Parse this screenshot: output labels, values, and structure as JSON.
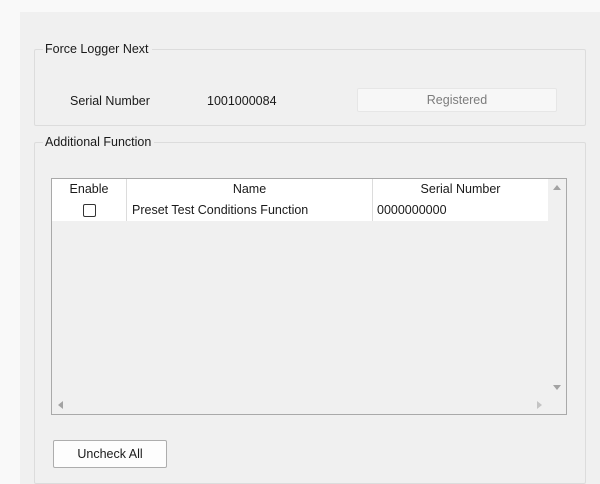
{
  "force_logger": {
    "title": "Force Logger Next",
    "serial_label": "Serial Number",
    "serial_value": "1001000084",
    "status": "Registered"
  },
  "additional_function": {
    "title": "Additional Function",
    "columns": {
      "enable": "Enable",
      "name": "Name",
      "serial": "Serial Number"
    },
    "rows": [
      {
        "enabled": false,
        "name": "Preset Test Conditions Function",
        "serial": "0000000000"
      }
    ],
    "uncheck_all_label": "Uncheck All"
  }
}
